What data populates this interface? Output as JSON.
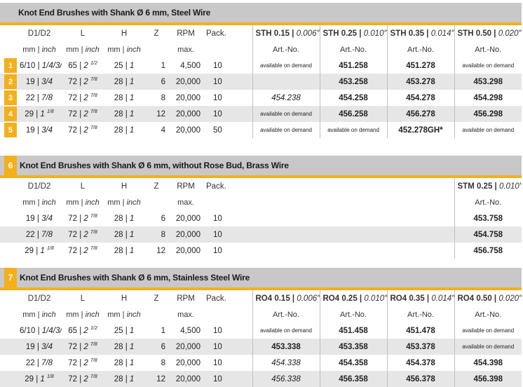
{
  "cols": {
    "d": "D1/D2",
    "l": "L",
    "h": "H",
    "z": "Z",
    "rpm": "RPM",
    "pack": "Pack.",
    "d_unit_mm": "mm",
    "d_unit_in": "inch",
    "sep": "|",
    "rpm_sub": "max.",
    "art_no": "Art.-No."
  },
  "s1": {
    "title": "Knot End Brushes with Shank Ø 6 mm, Steel Wire",
    "heads": [
      {
        "code": "STH 0.15",
        "inch": "0.006″"
      },
      {
        "code": "STH 0.25",
        "inch": "0.010″"
      },
      {
        "code": "STH 0.35",
        "inch": "0.014″"
      },
      {
        "code": "STH 0.50",
        "inch": "0.020″"
      }
    ],
    "rows": [
      {
        "n": "1",
        "d": "6/10",
        "di": "1/4/3/8",
        "l": "65",
        "li": "2",
        "lf": "1/2",
        "h": "25",
        "hi": "1",
        "z": "1",
        "rpm": "4,500",
        "pack": "10",
        "a": [
          "available on demand",
          "451.258",
          "451.278",
          "available on demand"
        ]
      },
      {
        "n": "2",
        "d": "19",
        "di": "3/4",
        "l": "72",
        "li": "2",
        "lf": "7/8",
        "h": "28",
        "hi": "1",
        "z": "6",
        "rpm": "20,000",
        "pack": "10",
        "a": [
          "",
          "453.258",
          "453.278",
          "453.298"
        ]
      },
      {
        "n": "3",
        "d": "22",
        "di": "7/8",
        "l": "72",
        "li": "2",
        "lf": "7/8",
        "h": "28",
        "hi": "1",
        "z": "8",
        "rpm": "20,000",
        "pack": "10",
        "a": [
          "454.238",
          "454.258",
          "454.278",
          "454.298"
        ]
      },
      {
        "n": "4",
        "d": "29",
        "di": "1",
        "dif": "1/8",
        "l": "72",
        "li": "2",
        "lf": "7/8",
        "h": "28",
        "hi": "1",
        "z": "12",
        "rpm": "20,000",
        "pack": "10",
        "a": [
          "available on demand",
          "456.258",
          "456.278",
          "456.298"
        ]
      },
      {
        "n": "5",
        "d": "19",
        "di": "3/4",
        "l": "72",
        "li": "2",
        "lf": "7/8",
        "h": "28",
        "hi": "1",
        "z": "4",
        "rpm": "20,000",
        "pack": "50",
        "a": [
          "available on demand",
          "available on demand",
          "452.278GH*",
          "available on demand"
        ]
      }
    ]
  },
  "s2": {
    "num": "6",
    "title": "Knot End Brushes with Shank Ø 6 mm, without Rose Bud, Brass Wire",
    "head": {
      "code": "STM 0.25",
      "inch": "0.010″"
    },
    "rows": [
      {
        "d": "19",
        "di": "3/4",
        "l": "72",
        "li": "2",
        "lf": "7/8",
        "h": "28",
        "hi": "1",
        "z": "6",
        "rpm": "20,000",
        "pack": "10",
        "a": "453.758"
      },
      {
        "d": "22",
        "di": "7/8",
        "l": "72",
        "li": "2",
        "lf": "7/8",
        "h": "28",
        "hi": "1",
        "z": "8",
        "rpm": "20,000",
        "pack": "10",
        "a": "454.758"
      },
      {
        "d": "29",
        "di": "1",
        "dif": "1/8",
        "l": "72",
        "li": "2",
        "lf": "7/8",
        "h": "28",
        "hi": "1",
        "z": "12",
        "rpm": "20,000",
        "pack": "10",
        "a": "456.758"
      }
    ]
  },
  "s3": {
    "num": "7",
    "title": "Knot End Brushes with Shank Ø 6 mm, Stainless Steel Wire",
    "heads": [
      {
        "code": "RO4 0.15",
        "inch": "0.006″"
      },
      {
        "code": "RO4 0.25",
        "inch": "0.010″"
      },
      {
        "code": "RO4 0.35",
        "inch": "0.014″"
      },
      {
        "code": "RO4 0.50",
        "inch": "0.020″"
      }
    ],
    "rows": [
      {
        "d": "6/10",
        "di": "1/4/3/8",
        "l": "65",
        "li": "2",
        "lf": "1/2",
        "h": "25",
        "hi": "1",
        "z": "1",
        "rpm": "4,500",
        "pack": "10",
        "a": [
          "available on demand",
          "451.458",
          "451.478",
          "available on demand"
        ]
      },
      {
        "d": "19",
        "di": "3/4",
        "l": "72",
        "li": "2",
        "lf": "7/8",
        "h": "28",
        "hi": "1",
        "z": "6",
        "rpm": "20,000",
        "pack": "10",
        "a": [
          "453.338",
          "453.358",
          "453.378",
          "available on demand"
        ]
      },
      {
        "d": "22",
        "di": "7/8",
        "l": "72",
        "li": "2",
        "lf": "7/8",
        "h": "28",
        "hi": "1",
        "z": "8",
        "rpm": "20,000",
        "pack": "10",
        "a": [
          "454.338",
          "454.358",
          "454.378",
          "454.398"
        ]
      },
      {
        "d": "29",
        "di": "1",
        "dif": "1/8",
        "l": "72",
        "li": "2",
        "lf": "7/8",
        "h": "28",
        "hi": "1",
        "z": "12",
        "rpm": "20,000",
        "pack": "10",
        "a": [
          "456.338",
          "456.358",
          "456.378",
          "456.398"
        ]
      }
    ]
  },
  "styles": {
    "s1_art_bold": [
      [
        false,
        true,
        true,
        false
      ],
      [
        false,
        true,
        true,
        true
      ],
      [
        false,
        true,
        true,
        true
      ],
      [
        false,
        true,
        true,
        true
      ],
      [
        false,
        false,
        true,
        false
      ]
    ],
    "s1_art_italic": [
      [
        false,
        false,
        false,
        false
      ],
      [
        false,
        false,
        false,
        false
      ],
      [
        true,
        false,
        false,
        false
      ],
      [
        false,
        false,
        false,
        false
      ],
      [
        false,
        false,
        false,
        false
      ]
    ],
    "s3_art_bold": [
      [
        false,
        true,
        true,
        false
      ],
      [
        true,
        true,
        true,
        false
      ],
      [
        false,
        true,
        true,
        true
      ],
      [
        false,
        true,
        true,
        true
      ]
    ],
    "s3_art_italic": [
      [
        false,
        false,
        false,
        false
      ],
      [
        false,
        false,
        false,
        false
      ],
      [
        true,
        false,
        false,
        false
      ],
      [
        true,
        false,
        false,
        false
      ]
    ]
  }
}
